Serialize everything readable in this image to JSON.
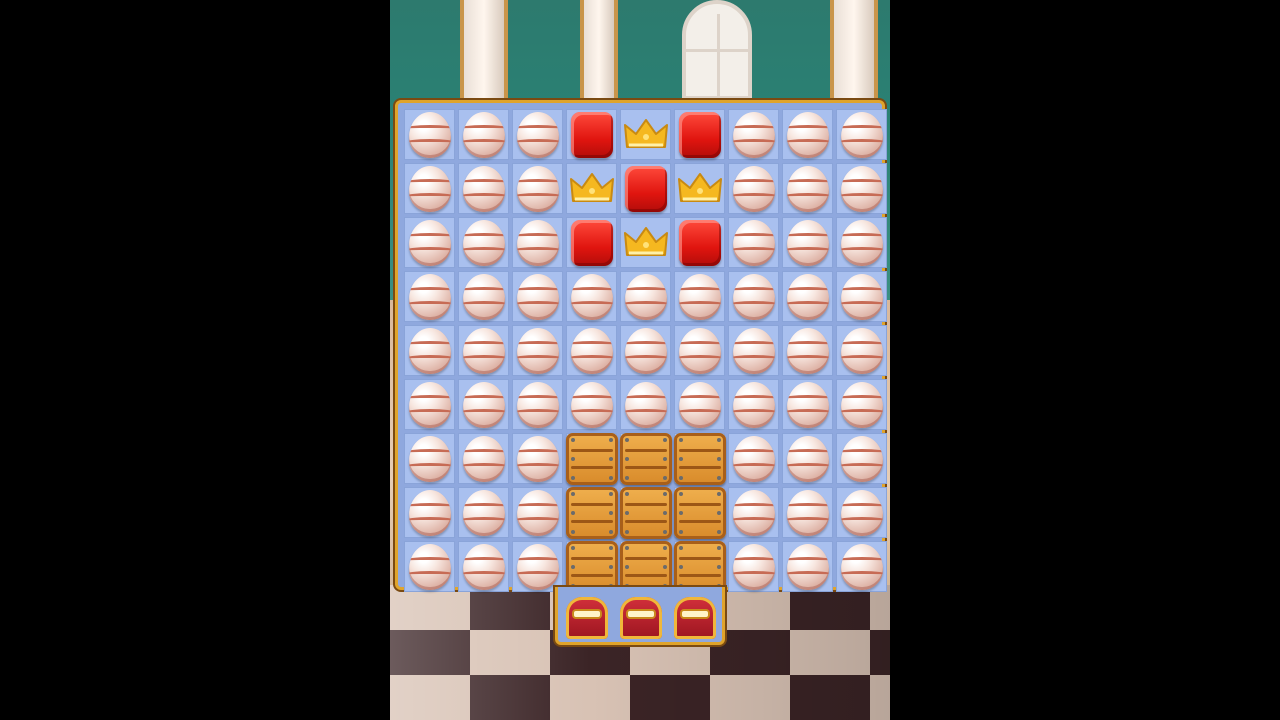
{
  "game": {
    "board_rows": 9,
    "board_cols": 9,
    "grid": [
      [
        "egg",
        "egg",
        "egg",
        "red-block",
        "crown",
        "red-block",
        "egg",
        "egg",
        "egg"
      ],
      [
        "egg",
        "egg",
        "egg",
        "crown",
        "red-block",
        "crown",
        "egg",
        "egg",
        "egg"
      ],
      [
        "egg",
        "egg",
        "egg",
        "red-block",
        "crown",
        "red-block",
        "egg",
        "egg",
        "egg"
      ],
      [
        "egg",
        "egg",
        "egg",
        "egg",
        "egg",
        "egg",
        "egg",
        "egg",
        "egg"
      ],
      [
        "egg",
        "egg",
        "egg",
        "egg",
        "egg",
        "egg",
        "egg",
        "egg",
        "egg"
      ],
      [
        "egg",
        "egg",
        "egg",
        "egg",
        "egg",
        "egg",
        "egg",
        "egg",
        "egg"
      ],
      [
        "egg",
        "egg",
        "egg",
        "crate",
        "crate",
        "crate",
        "egg",
        "egg",
        "egg"
      ],
      [
        "egg",
        "egg",
        "egg",
        "crate",
        "crate",
        "crate",
        "egg",
        "egg",
        "egg"
      ],
      [
        "egg",
        "egg",
        "egg",
        "crate",
        "crate",
        "crate",
        "egg",
        "egg",
        "egg"
      ]
    ],
    "collectors": [
      "mailbox",
      "mailbox",
      "mailbox"
    ],
    "collector_columns": [
      3,
      4,
      5
    ]
  },
  "colors": {
    "board_border": "#e0a42b",
    "cell": "#a9c0ef",
    "red_block": "#e0150f",
    "crown": "#f5b820",
    "crate": "#e09a3a"
  },
  "icons": {
    "egg": "patterned-egg-icon",
    "red-block": "red-jelly-block-icon",
    "crown": "gold-crown-icon",
    "crate": "wooden-crate-icon",
    "mailbox": "red-mailbox-collector-icon"
  }
}
